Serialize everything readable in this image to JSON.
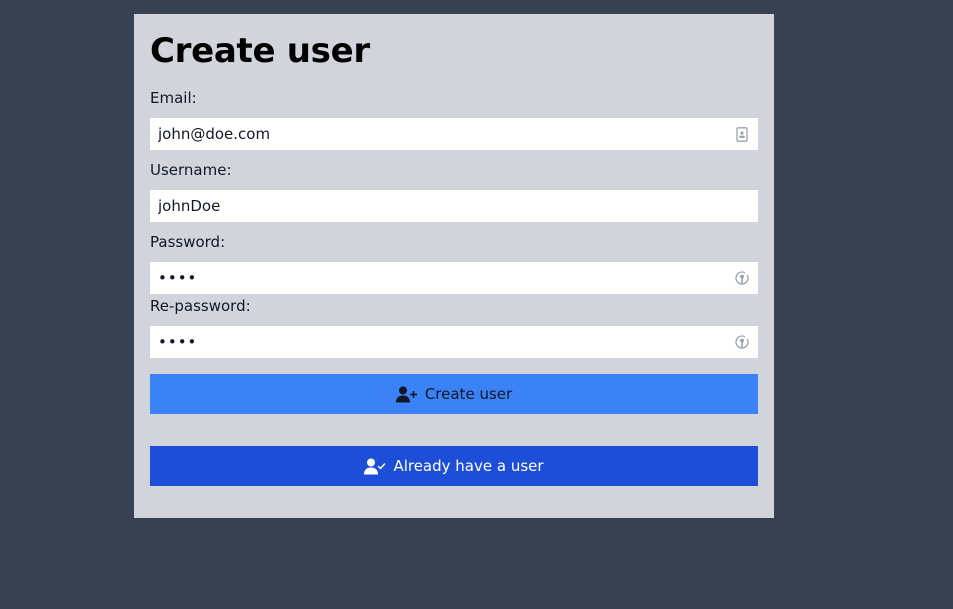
{
  "form": {
    "title": "Create user",
    "email": {
      "label": "Email:",
      "value": "john@doe.com",
      "icon": "contact-card-icon"
    },
    "username": {
      "label": "Username:",
      "value": "johnDoe"
    },
    "password": {
      "label": "Password:",
      "value": "••••",
      "icon": "key-autofill-icon"
    },
    "repassword": {
      "label": "Re-password:",
      "value": "••••",
      "icon": "key-autofill-icon"
    },
    "create_button": {
      "label": "Create user",
      "icon": "user-plus-icon",
      "color": "#3b82f6"
    },
    "login_button": {
      "label": "Already have a user",
      "icon": "user-check-icon",
      "color": "#1d4ed8"
    }
  },
  "colors": {
    "background": "#374151",
    "card": "#d1d5db"
  }
}
